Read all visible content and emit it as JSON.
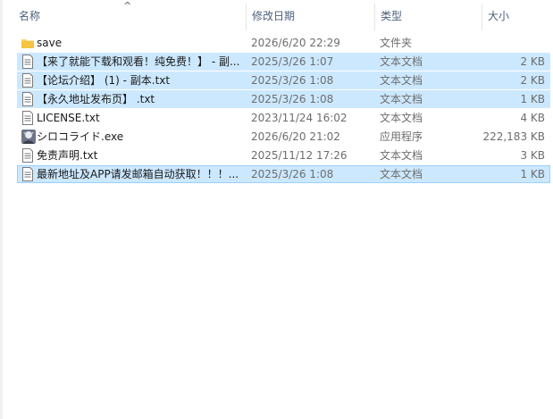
{
  "columns": {
    "name": "名称",
    "date": "修改日期",
    "type": "类型",
    "size": "大小"
  },
  "sort_indicator": "^",
  "files": [
    {
      "name": "save",
      "date": "2026/6/20 22:29",
      "type": "文件夹",
      "size": "",
      "icon": "folder-icon",
      "selected": false
    },
    {
      "name": "【来了就能下载和观看！纯免费！】 - 副...",
      "date": "2025/3/26 1:07",
      "type": "文本文档",
      "size": "2 KB",
      "icon": "text-file-icon",
      "selected": true
    },
    {
      "name": "【论坛介绍】 (1) - 副本.txt",
      "date": "2025/3/26 1:08",
      "type": "文本文档",
      "size": "2 KB",
      "icon": "text-file-icon",
      "selected": true
    },
    {
      "name": "【永久地址发布页】 .txt",
      "date": "2025/3/26 1:08",
      "type": "文本文档",
      "size": "1 KB",
      "icon": "text-file-icon",
      "selected": true
    },
    {
      "name": "LICENSE.txt",
      "date": "2023/11/24 16:02",
      "type": "文本文档",
      "size": "4 KB",
      "icon": "text-file-icon",
      "selected": false
    },
    {
      "name": "シロコライド.exe",
      "date": "2026/6/20 21:02",
      "type": "应用程序",
      "size": "222,183 KB",
      "icon": "app-icon",
      "selected": false
    },
    {
      "name": "免责声明.txt",
      "date": "2025/11/12 17:26",
      "type": "文本文档",
      "size": "3 KB",
      "icon": "text-file-icon",
      "selected": false
    },
    {
      "name": "最新地址及APP请发邮箱自动获取！！！...",
      "date": "2025/3/26 1:08",
      "type": "文本文档",
      "size": "1 KB",
      "icon": "text-file-icon",
      "selected": true
    }
  ]
}
